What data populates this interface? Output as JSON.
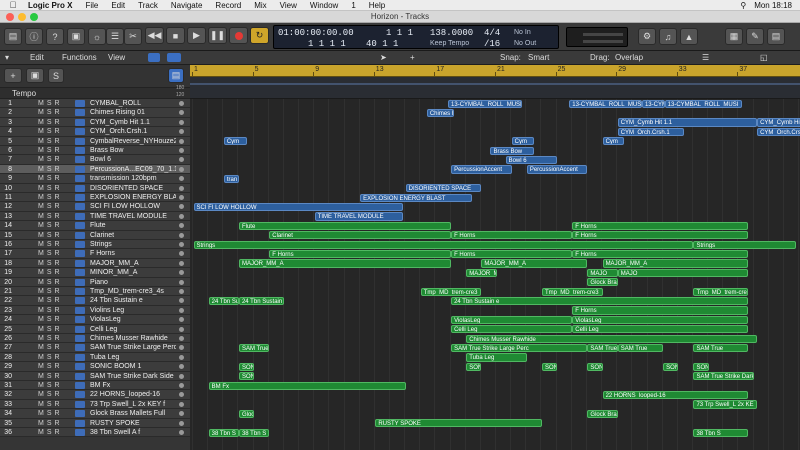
{
  "menubar": {
    "app": "Logic Pro X",
    "items": [
      "File",
      "Edit",
      "Track",
      "Navigate",
      "Record",
      "Mix",
      "View",
      "Window",
      "1",
      "Help"
    ],
    "clock": "Mon 18:18"
  },
  "window": {
    "title": "Horizon - Tracks"
  },
  "lcd": {
    "time": "01:00:00:00.00",
    "time_sub": "1 1 1 1",
    "bars": "1 1 1",
    "bars_sub": "40 1 1",
    "bpm": "138.0000",
    "bpm_sub": "Keep Tempo",
    "sig": "4/4",
    "division": "/16",
    "in": "No In",
    "out": "No Out"
  },
  "secbar": {
    "edit": "Edit",
    "functions": "Functions",
    "view": "View",
    "snap_label": "Snap:",
    "snap_value": "Smart",
    "drag_label": "Drag:",
    "drag_value": "Overlap"
  },
  "ruler": {
    "marks": [
      "1",
      "5",
      "9",
      "13",
      "17",
      "21",
      "25",
      "29",
      "33",
      "37"
    ]
  },
  "tempo_label": "Tempo",
  "tempo_scale": [
    "180",
    "120"
  ],
  "tracks": [
    {
      "num": "1",
      "name": "CYMBAL_ROLL"
    },
    {
      "num": "2",
      "name": "Chimes Rising 01"
    },
    {
      "num": "3",
      "name": "CYM_Cymb Hit 1.1"
    },
    {
      "num": "4",
      "name": "CYM_Orch.Crsh.1"
    },
    {
      "num": "5",
      "name": "CymbalReverse_NYHouze2"
    },
    {
      "num": "6",
      "name": "Brass Bow"
    },
    {
      "num": "7",
      "name": "Bowl 6"
    },
    {
      "num": "8",
      "name": "PercussionA...EC09_70_1.1"
    },
    {
      "num": "9",
      "name": "transmission 120bpm"
    },
    {
      "num": "10",
      "name": "DISORIENTED SPACE"
    },
    {
      "num": "11",
      "name": "EXPLOSION ENERGY BLAST"
    },
    {
      "num": "12",
      "name": "SCI FI LOW HOLLOW"
    },
    {
      "num": "13",
      "name": "TIME TRAVEL MODULE"
    },
    {
      "num": "14",
      "name": "Flute"
    },
    {
      "num": "15",
      "name": "Clarinet"
    },
    {
      "num": "16",
      "name": "Strings"
    },
    {
      "num": "17",
      "name": "F Horns"
    },
    {
      "num": "18",
      "name": "MAJOR_MM_A"
    },
    {
      "num": "19",
      "name": "MINOR_MM_A"
    },
    {
      "num": "20",
      "name": "Piano"
    },
    {
      "num": "21",
      "name": "Tmp_MD_trem-cre3_4s"
    },
    {
      "num": "22",
      "name": "24 Tbn Sustain e"
    },
    {
      "num": "23",
      "name": "Violins Leg"
    },
    {
      "num": "24",
      "name": "ViolasLeg"
    },
    {
      "num": "25",
      "name": "Celli Leg"
    },
    {
      "num": "26",
      "name": "Chimes Musser Rawhide"
    },
    {
      "num": "27",
      "name": "SAM True Strike Large Perc"
    },
    {
      "num": "28",
      "name": "Tuba Leg"
    },
    {
      "num": "29",
      "name": "SONIC BOOM 1"
    },
    {
      "num": "30",
      "name": "SAM True Strike Dark Side"
    },
    {
      "num": "31",
      "name": "BM Fx"
    },
    {
      "num": "32",
      "name": "22 HORNS_looped-16"
    },
    {
      "num": "33",
      "name": "73 Trp Swell_L 2x KEY f"
    },
    {
      "num": "34",
      "name": "Glock Brass Mallets Full"
    },
    {
      "num": "35",
      "name": "RUSTY SPOKE"
    },
    {
      "num": "36",
      "name": "38 Tbn Swell A f"
    }
  ],
  "regions": [
    {
      "t": 0,
      "c": "b",
      "label": "13-CYMBAL_ROLL_MUSI",
      "s": 16.9,
      "e": 21.8
    },
    {
      "t": 0,
      "c": "b",
      "label": "13-CYMBAL_ROLL_MUSI",
      "s": 24.9,
      "e": 29.7
    },
    {
      "t": 0,
      "c": "b",
      "label": "13-CYMB",
      "s": 29.7,
      "e": 31.2
    },
    {
      "t": 0,
      "c": "b",
      "label": "13-CYMBAL_ROLL_MUSI",
      "s": 31.2,
      "e": 36.3
    },
    {
      "t": 1,
      "c": "b",
      "label": "Chimes Ri",
      "s": 15.5,
      "e": 17.3
    },
    {
      "t": 2,
      "c": "b",
      "label": "CYM_Cymb Hit 1.1",
      "s": 28.1,
      "e": 37.3
    },
    {
      "t": 2,
      "c": "b",
      "label": "CYM_Cymb Hit",
      "s": 37.3,
      "e": 40.6
    },
    {
      "t": 3,
      "c": "b",
      "label": "CYM_Orch.Crsh.1",
      "s": 28.1,
      "e": 32.5
    },
    {
      "t": 3,
      "c": "b",
      "label": "CYM_Orch.Crsh",
      "s": 37.3,
      "e": 40.6
    },
    {
      "t": 4,
      "c": "b",
      "label": "Cym",
      "s": 2.1,
      "e": 3.6
    },
    {
      "t": 4,
      "c": "b",
      "label": "Cym",
      "s": 21.1,
      "e": 22.6
    },
    {
      "t": 4,
      "c": "b",
      "label": "Cym",
      "s": 27.1,
      "e": 28.5
    },
    {
      "t": 5,
      "c": "b",
      "label": "Brass Bow",
      "s": 19.7,
      "e": 22.6
    },
    {
      "t": 6,
      "c": "b",
      "label": "Bowl 6",
      "s": 20.7,
      "e": 24.1
    },
    {
      "t": 7,
      "c": "b",
      "label": "PercussionAccent",
      "s": 17.1,
      "e": 21.1
    },
    {
      "t": 7,
      "c": "b",
      "label": "PercussionAccent",
      "s": 22.1,
      "e": 26.1
    },
    {
      "t": 8,
      "c": "b",
      "label": "tran",
      "s": 2.1,
      "e": 3.1
    },
    {
      "t": 9,
      "c": "b",
      "label": "DISORIENTED SPACE",
      "s": 14.1,
      "e": 19.1
    },
    {
      "t": 10,
      "c": "b",
      "label": "EXPLOSION ENERGY BLAST",
      "s": 11.1,
      "e": 18.5
    },
    {
      "t": 11,
      "c": "b",
      "label": "SCI FI LOW HOLLOW",
      "s": 0.1,
      "e": 13.9
    },
    {
      "t": 12,
      "c": "b",
      "label": "TIME TRAVEL MODULE",
      "s": 8.1,
      "e": 13.9
    },
    {
      "t": 13,
      "c": "g",
      "label": "Flute",
      "s": 3.1,
      "e": 17.1
    },
    {
      "t": 13,
      "c": "g",
      "label": "F Horns",
      "s": 25.1,
      "e": 36.7
    },
    {
      "t": 14,
      "c": "g",
      "label": "Clarinet",
      "s": 5.1,
      "e": 17.1
    },
    {
      "t": 14,
      "c": "g",
      "label": "F Horns",
      "s": 17.1,
      "e": 25.1
    },
    {
      "t": 14,
      "c": "g",
      "label": "F Horns",
      "s": 25.1,
      "e": 36.7
    },
    {
      "t": 15,
      "c": "g",
      "label": "Strings",
      "s": 0.1,
      "e": 33.1
    },
    {
      "t": 15,
      "c": "g",
      "label": "Strings",
      "s": 33.1,
      "e": 39.9
    },
    {
      "t": 16,
      "c": "g",
      "label": "F Horns",
      "s": 5.1,
      "e": 17.1
    },
    {
      "t": 16,
      "c": "g",
      "label": "F Horns",
      "s": 17.1,
      "e": 25.1
    },
    {
      "t": 16,
      "c": "g",
      "label": "F Horns",
      "s": 25.1,
      "e": 36.7
    },
    {
      "t": 17,
      "c": "g",
      "label": "MAJOR_MM_A",
      "s": 3.1,
      "e": 17.1
    },
    {
      "t": 17,
      "c": "g",
      "label": "MAJOR_MM_A",
      "s": 19.1,
      "e": 26.1
    },
    {
      "t": 17,
      "c": "g",
      "label": "MAJOR_MM_A",
      "s": 27.1,
      "e": 36.7
    },
    {
      "t": 18,
      "c": "g",
      "label": "MAJOR_MM_A",
      "s": 18.1,
      "e": 20.1
    },
    {
      "t": 18,
      "c": "g",
      "label": "MAJO",
      "s": 26.1,
      "e": 28.1
    },
    {
      "t": 18,
      "c": "g",
      "label": "MAJO",
      "s": 28.1,
      "e": 36.7
    },
    {
      "t": 19,
      "c": "g",
      "label": "Glock Bra",
      "s": 26.1,
      "e": 28.1
    },
    {
      "t": 20,
      "c": "g",
      "label": "Tmp_MD_trem-cre3_4",
      "s": 15.1,
      "e": 19.1
    },
    {
      "t": 20,
      "c": "g",
      "label": "Tmp_MD_trem-cre3_4",
      "s": 23.1,
      "e": 27.1
    },
    {
      "t": 20,
      "c": "g",
      "label": "Tmp_MD_trem-cre3_4",
      "s": 33.1,
      "e": 36.7
    },
    {
      "t": 21,
      "c": "g",
      "label": "24 Tbn Su",
      "s": 1.1,
      "e": 3.1
    },
    {
      "t": 21,
      "c": "g",
      "label": "24 Tbn Sustain",
      "s": 3.1,
      "e": 6.1
    },
    {
      "t": 21,
      "c": "g",
      "label": "24 Tbn Sustain e",
      "s": 17.1,
      "e": 36.7
    },
    {
      "t": 22,
      "c": "g",
      "label": "F Horns",
      "s": 25.1,
      "e": 36.7
    },
    {
      "t": 23,
      "c": "g",
      "label": "ViolasLeg",
      "s": 17.1,
      "e": 25.1
    },
    {
      "t": 23,
      "c": "g",
      "label": "ViolasLeg",
      "s": 25.1,
      "e": 36.7
    },
    {
      "t": 24,
      "c": "g",
      "label": "Celli Leg",
      "s": 17.1,
      "e": 25.1
    },
    {
      "t": 24,
      "c": "g",
      "label": "Celli Leg",
      "s": 25.1,
      "e": 36.7
    },
    {
      "t": 25,
      "c": "g",
      "label": "Chimes Musser Rawhide",
      "s": 18.1,
      "e": 37.3
    },
    {
      "t": 26,
      "c": "g",
      "label": "SAM True",
      "s": 3.1,
      "e": 5.1
    },
    {
      "t": 26,
      "c": "g",
      "label": "SAM True Strike Large Perc",
      "s": 17.1,
      "e": 26.1
    },
    {
      "t": 26,
      "c": "g",
      "label": "SAM True",
      "s": 26.1,
      "e": 28.1
    },
    {
      "t": 26,
      "c": "g",
      "label": "SAM True",
      "s": 28.1,
      "e": 31.1
    },
    {
      "t": 26,
      "c": "g",
      "label": "SAM True",
      "s": 33.1,
      "e": 36.7
    },
    {
      "t": 27,
      "c": "g",
      "label": "Tuba Leg",
      "s": 18.1,
      "e": 22.1
    },
    {
      "t": 28,
      "c": "g",
      "label": "SON",
      "s": 3.1,
      "e": 4.1
    },
    {
      "t": 28,
      "c": "g",
      "label": "SON",
      "s": 18.1,
      "e": 19.1
    },
    {
      "t": 28,
      "c": "g",
      "label": "SON",
      "s": 23.1,
      "e": 24.1
    },
    {
      "t": 28,
      "c": "g",
      "label": "SON",
      "s": 26.1,
      "e": 27.1
    },
    {
      "t": 28,
      "c": "g",
      "label": "SON",
      "s": 31.1,
      "e": 32.1
    },
    {
      "t": 28,
      "c": "g",
      "label": "SON",
      "s": 33.1,
      "e": 34.1
    },
    {
      "t": 29,
      "c": "g",
      "label": "SON",
      "s": 3.1,
      "e": 4.1
    },
    {
      "t": 29,
      "c": "g",
      "label": "SAM True Strike Dark",
      "s": 33.1,
      "e": 37.1
    },
    {
      "t": 30,
      "c": "g",
      "label": "BM Fx",
      "s": 1.1,
      "e": 14.1
    },
    {
      "t": 31,
      "c": "g",
      "label": "22 HORNS_looped-16",
      "s": 27.1,
      "e": 36.7
    },
    {
      "t": 32,
      "c": "g",
      "label": "73 Trp Swell_L 2x KE",
      "s": 33.1,
      "e": 37.3
    },
    {
      "t": 33,
      "c": "g",
      "label": "Glocl",
      "s": 3.1,
      "e": 4.1
    },
    {
      "t": 33,
      "c": "g",
      "label": "Glock Bra",
      "s": 26.1,
      "e": 28.1
    },
    {
      "t": 34,
      "c": "g",
      "label": "RUSTY SPOKE",
      "s": 12.1,
      "e": 23.1
    },
    {
      "t": 35,
      "c": "g",
      "label": "38 Tbn S",
      "s": 1.1,
      "e": 3.1
    },
    {
      "t": 35,
      "c": "g",
      "label": "38 Tbn S",
      "s": 3.1,
      "e": 5.1
    },
    {
      "t": 35,
      "c": "g",
      "label": "38 Tbn S",
      "s": 33.1,
      "e": 36.7
    }
  ]
}
